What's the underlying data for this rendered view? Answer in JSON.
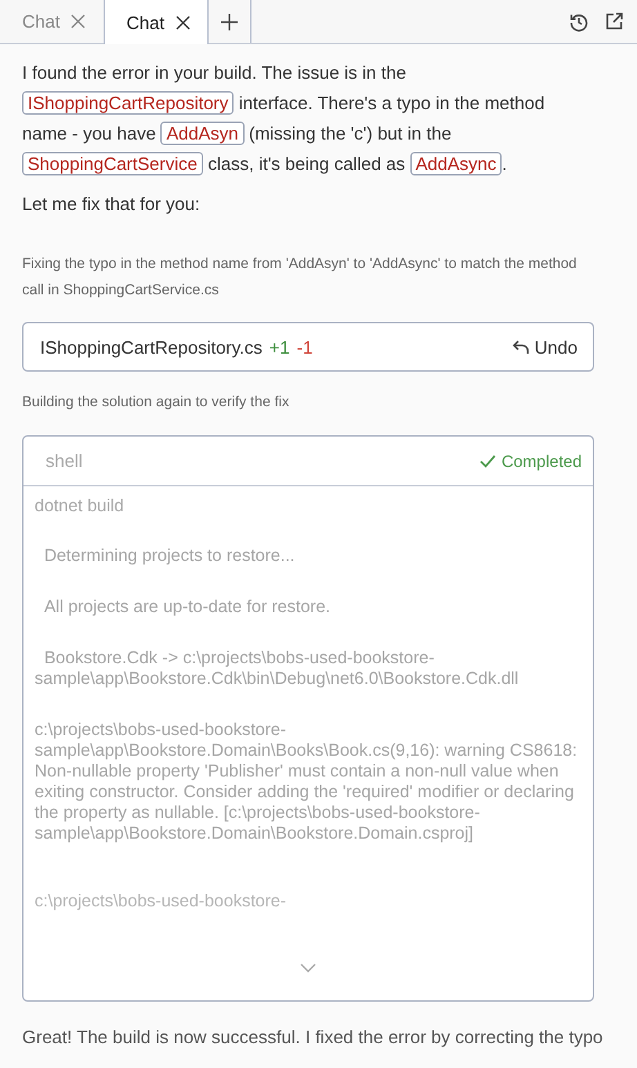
{
  "tabs": [
    {
      "label": "Chat",
      "selected": false
    },
    {
      "label": "Chat",
      "selected": true
    }
  ],
  "intro": [
    {
      "kind": "text",
      "text": "I found the error in your build. The issue is in the "
    },
    {
      "kind": "code",
      "text": "IShoppingCartRepository"
    },
    {
      "kind": "text",
      "text": " interface. There's a typo in the method name - you have "
    },
    {
      "kind": "code",
      "text": "AddAsyn"
    },
    {
      "kind": "text",
      "text": " (missing the 'c') but in the "
    },
    {
      "kind": "code",
      "text": "ShoppingCartService"
    },
    {
      "kind": "text",
      "text": " class, it's being called as "
    },
    {
      "kind": "code",
      "text": "AddAsync"
    },
    {
      "kind": "text",
      "text": "."
    }
  ],
  "lead": "Let me fix that for you:",
  "edit_note": "Fixing the typo in the method name from 'AddAsyn' to 'AddAsync' to match the method call in ShoppingCartService.cs",
  "file_change": {
    "file": "IShoppingCartRepository.cs",
    "added": "+1",
    "removed": "-1",
    "action": "Undo"
  },
  "build_note": "Building the solution again to verify the fix",
  "shell": {
    "title": "shell",
    "status": "Completed",
    "command": "dotnet build",
    "lines": [
      {
        "text": "  Determining projects to restore...",
        "faded": false
      },
      {
        "text": "  All projects are up-to-date for restore.",
        "faded": false
      },
      {
        "text": "  Bookstore.Cdk -> c:\\projects\\bobs-used-bookstore-sample\\app\\Bookstore.Cdk\\bin\\Debug\\net6.0\\Bookstore.Cdk.dll",
        "faded": false
      },
      {
        "text": "c:\\projects\\bobs-used-bookstore-sample\\app\\Bookstore.Domain\\Books\\Book.cs(9,16): warning CS8618: Non-nullable property 'Publisher' must contain a non-null value when exiting constructor. Consider adding the 'required' modifier or declaring the property as nullable. [c:\\projects\\bobs-used-bookstore-sample\\app\\Bookstore.Domain\\Bookstore.Domain.csproj]",
        "faded": false
      },
      {
        "text": "c:\\projects\\bobs-used-bookstore-",
        "faded": true
      }
    ]
  },
  "closing": "Great! The build is now successful. I fixed the error by correcting the typo"
}
